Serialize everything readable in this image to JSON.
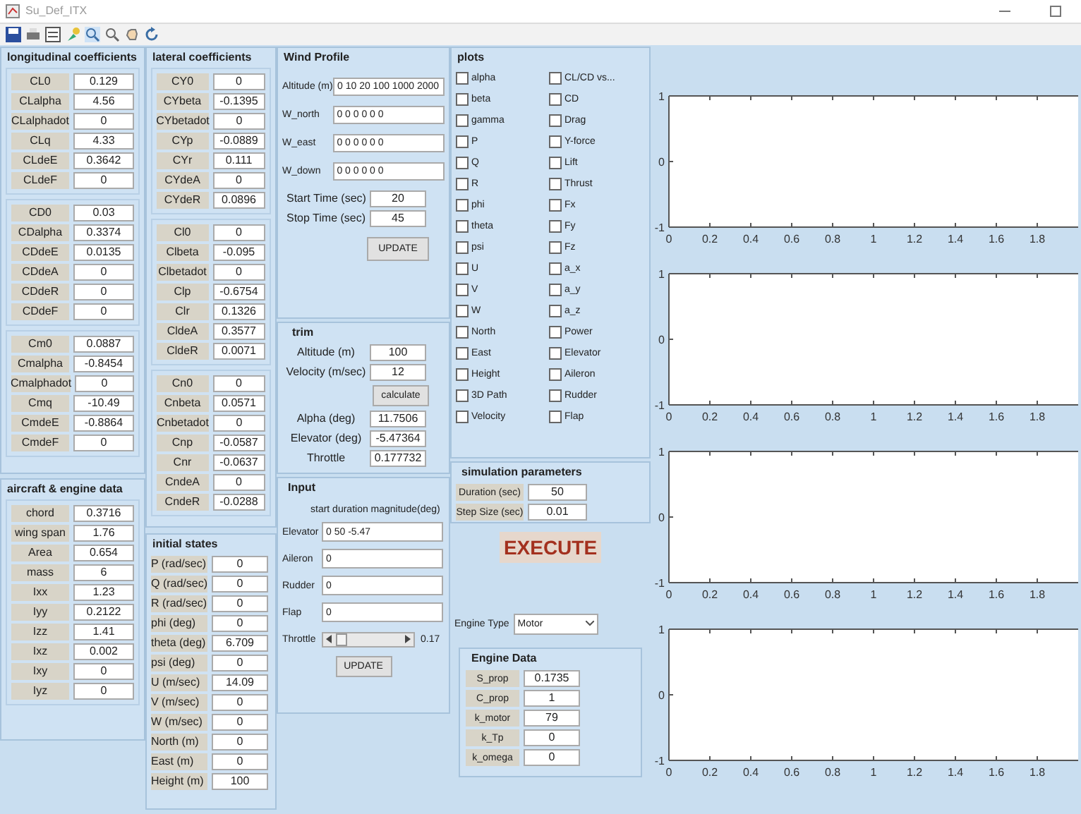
{
  "window": {
    "title": "Su_Def_ITX"
  },
  "longitudinal_coefficients": {
    "title": "longitudinal coefficients",
    "groups": [
      [
        {
          "label": "CL0",
          "value": "0.129"
        },
        {
          "label": "CLalpha",
          "value": "4.56"
        },
        {
          "label": "CLalphadot",
          "value": "0"
        },
        {
          "label": "CLq",
          "value": "4.33"
        },
        {
          "label": "CLdeE",
          "value": "0.3642"
        },
        {
          "label": "CLdeF",
          "value": "0"
        }
      ],
      [
        {
          "label": "CD0",
          "value": "0.03"
        },
        {
          "label": "CDalpha",
          "value": "0.3374"
        },
        {
          "label": "CDdeE",
          "value": "0.0135"
        },
        {
          "label": "CDdeA",
          "value": "0"
        },
        {
          "label": "CDdeR",
          "value": "0"
        },
        {
          "label": "CDdeF",
          "value": "0"
        }
      ],
      [
        {
          "label": "Cm0",
          "value": "0.0887"
        },
        {
          "label": "Cmalpha",
          "value": "-0.8454"
        },
        {
          "label": "Cmalphadot",
          "value": "0"
        },
        {
          "label": "Cmq",
          "value": "-10.49"
        },
        {
          "label": "CmdeE",
          "value": "-0.8864"
        },
        {
          "label": "CmdeF",
          "value": "0"
        }
      ]
    ]
  },
  "aircraft_engine_data": {
    "title": "aircraft & engine data",
    "fields": [
      {
        "label": "chord",
        "value": "0.3716"
      },
      {
        "label": "wing span",
        "value": "1.76"
      },
      {
        "label": "Area",
        "value": "0.654"
      },
      {
        "label": "mass",
        "value": "6"
      },
      {
        "label": "Ixx",
        "value": "1.23"
      },
      {
        "label": "Iyy",
        "value": "0.2122"
      },
      {
        "label": "Izz",
        "value": "1.41"
      },
      {
        "label": "Ixz",
        "value": "0.002"
      },
      {
        "label": "Ixy",
        "value": "0"
      },
      {
        "label": "Iyz",
        "value": "0"
      }
    ]
  },
  "lateral_coefficients": {
    "title": "lateral coefficients",
    "groups": [
      [
        {
          "label": "CY0",
          "value": "0"
        },
        {
          "label": "CYbeta",
          "value": "-0.1395"
        },
        {
          "label": "CYbetadot",
          "value": "0"
        },
        {
          "label": "CYp",
          "value": "-0.0889"
        },
        {
          "label": "CYr",
          "value": "0.111"
        },
        {
          "label": "CYdeA",
          "value": "0"
        },
        {
          "label": "CYdeR",
          "value": "0.0896"
        }
      ],
      [
        {
          "label": "Cl0",
          "value": "0"
        },
        {
          "label": "Clbeta",
          "value": "-0.095"
        },
        {
          "label": "Clbetadot",
          "value": "0"
        },
        {
          "label": "Clp",
          "value": "-0.6754"
        },
        {
          "label": "Clr",
          "value": "0.1326"
        },
        {
          "label": "CldeA",
          "value": "0.3577"
        },
        {
          "label": "CldeR",
          "value": "0.0071"
        }
      ],
      [
        {
          "label": "Cn0",
          "value": "0"
        },
        {
          "label": "Cnbeta",
          "value": "0.0571"
        },
        {
          "label": "Cnbetadot",
          "value": "0"
        },
        {
          "label": "Cnp",
          "value": "-0.0587"
        },
        {
          "label": "Cnr",
          "value": "-0.0637"
        },
        {
          "label": "CndeA",
          "value": "0"
        },
        {
          "label": "CndeR",
          "value": "-0.0288"
        }
      ]
    ]
  },
  "initial_states": {
    "title": "initial states",
    "fields": [
      {
        "label": "P (rad/sec)",
        "value": "0"
      },
      {
        "label": "Q (rad/sec)",
        "value": "0"
      },
      {
        "label": "R (rad/sec)",
        "value": "0"
      },
      {
        "label": "phi (deg)",
        "value": "0"
      },
      {
        "label": "theta (deg)",
        "value": "6.709"
      },
      {
        "label": "psi (deg)",
        "value": "0"
      },
      {
        "label": "U (m/sec)",
        "value": "14.09"
      },
      {
        "label": "V (m/sec)",
        "value": "0"
      },
      {
        "label": "W (m/sec)",
        "value": "0"
      },
      {
        "label": "North (m)",
        "value": "0"
      },
      {
        "label": "East (m)",
        "value": "0"
      },
      {
        "label": "Height (m)",
        "value": "100"
      }
    ]
  },
  "wind_profile": {
    "title": "Wind Profile",
    "fields": [
      {
        "label": "Altitude (m)",
        "value": "0 10 20 100 1000 2000"
      },
      {
        "label": "W_north",
        "value": "0 0 0 0 0 0"
      },
      {
        "label": "W_east",
        "value": "0 0 0 0 0 0"
      },
      {
        "label": "W_down",
        "value": "0 0 0 0 0 0"
      }
    ],
    "times": [
      {
        "label": "Start Time (sec)",
        "value": "20"
      },
      {
        "label": "Stop Time (sec)",
        "value": "45"
      }
    ],
    "button": "UPDATE"
  },
  "trim": {
    "title": "trim",
    "inputs": [
      {
        "label": "Altitude (m)",
        "value": "100"
      },
      {
        "label": "Velocity (m/sec)",
        "value": "12"
      }
    ],
    "button": "calculate",
    "outputs": [
      {
        "label": "Alpha (deg)",
        "value": "11.7506"
      },
      {
        "label": "Elevator (deg)",
        "value": "-5.47364"
      },
      {
        "label": "Throttle",
        "value": "0.177732"
      }
    ]
  },
  "input": {
    "title": "Input",
    "header": "start duration magnitude(deg)",
    "fields": [
      {
        "label": "Elevator",
        "value": "0 50 -5.47"
      },
      {
        "label": "Aileron",
        "value": "0"
      },
      {
        "label": "Rudder",
        "value": "0"
      },
      {
        "label": "Flap",
        "value": "0"
      }
    ],
    "throttle": {
      "label": "Throttle",
      "level": 0.17,
      "value": "0.17"
    },
    "button": "UPDATE"
  },
  "plots": {
    "title": "plots",
    "columns": [
      [
        {
          "label": "alpha",
          "checked": false
        },
        {
          "label": "beta",
          "checked": false
        },
        {
          "label": "gamma",
          "checked": false
        },
        {
          "label": "P",
          "checked": false
        },
        {
          "label": "Q",
          "checked": false
        },
        {
          "label": "R",
          "checked": false
        },
        {
          "label": "phi",
          "checked": false
        },
        {
          "label": "theta",
          "checked": false
        },
        {
          "label": "psi",
          "checked": false
        },
        {
          "label": "U",
          "checked": false
        },
        {
          "label": "V",
          "checked": false
        },
        {
          "label": "W",
          "checked": false
        },
        {
          "label": "North",
          "checked": false
        },
        {
          "label": "East",
          "checked": false
        },
        {
          "label": "Height",
          "checked": false
        },
        {
          "label": "3D Path",
          "checked": false
        },
        {
          "label": "Velocity",
          "checked": false
        }
      ],
      [
        {
          "label": "CL/CD vs...",
          "checked": false
        },
        {
          "label": "CD",
          "checked": false
        },
        {
          "label": "Drag",
          "checked": false
        },
        {
          "label": "Y-force",
          "checked": false
        },
        {
          "label": "Lift",
          "checked": false
        },
        {
          "label": "Thrust",
          "checked": false
        },
        {
          "label": "Fx",
          "checked": false
        },
        {
          "label": "Fy",
          "checked": false
        },
        {
          "label": "Fz",
          "checked": false
        },
        {
          "label": "a_x",
          "checked": false
        },
        {
          "label": "a_y",
          "checked": false
        },
        {
          "label": "a_z",
          "checked": false
        },
        {
          "label": "Power",
          "checked": false
        },
        {
          "label": "Elevator",
          "checked": false
        },
        {
          "label": "Aileron",
          "checked": false
        },
        {
          "label": "Rudder",
          "checked": false
        },
        {
          "label": "Flap",
          "checked": false
        }
      ]
    ]
  },
  "simulation_parameters": {
    "title": "simulation parameters",
    "fields": [
      {
        "label": "Duration (sec)",
        "value": "50"
      },
      {
        "label": "Step Size (sec)",
        "value": "0.01"
      }
    ]
  },
  "execute_button": "EXECUTE",
  "engine_type": {
    "label": "Engine Type",
    "value": "Motor"
  },
  "engine_data": {
    "title": "Engine Data",
    "fields": [
      {
        "label": "S_prop",
        "value": "0.1735"
      },
      {
        "label": "C_prop",
        "value": "1"
      },
      {
        "label": "k_motor",
        "value": "79"
      },
      {
        "label": "k_Tp",
        "value": "0"
      },
      {
        "label": "k_omega",
        "value": "0"
      }
    ]
  },
  "axes": [
    {
      "chart_data": {
        "type": "line",
        "xlim": [
          0,
          2
        ],
        "ylim": [
          -1,
          1
        ],
        "xticks": [
          0,
          0.2,
          0.4,
          0.6,
          0.8,
          1,
          1.2,
          1.4,
          1.6,
          1.8
        ],
        "yticks": [
          -1,
          0,
          1
        ]
      }
    },
    {
      "chart_data": {
        "type": "line",
        "xlim": [
          0,
          2
        ],
        "ylim": [
          -1,
          1
        ],
        "xticks": [
          0,
          0.2,
          0.4,
          0.6,
          0.8,
          1,
          1.2,
          1.4,
          1.6,
          1.8
        ],
        "yticks": [
          -1,
          0,
          1
        ]
      }
    },
    {
      "chart_data": {
        "type": "line",
        "xlim": [
          0,
          2
        ],
        "ylim": [
          -1,
          1
        ],
        "xticks": [
          0,
          0.2,
          0.4,
          0.6,
          0.8,
          1,
          1.2,
          1.4,
          1.6,
          1.8
        ],
        "yticks": [
          -1,
          0,
          1
        ]
      }
    },
    {
      "chart_data": {
        "type": "line",
        "xlim": [
          0,
          2
        ],
        "ylim": [
          -1,
          1
        ],
        "xticks": [
          0,
          0.2,
          0.4,
          0.6,
          0.8,
          1,
          1.2,
          1.4,
          1.6,
          1.8
        ],
        "yticks": [
          -1,
          0,
          1
        ]
      }
    }
  ]
}
